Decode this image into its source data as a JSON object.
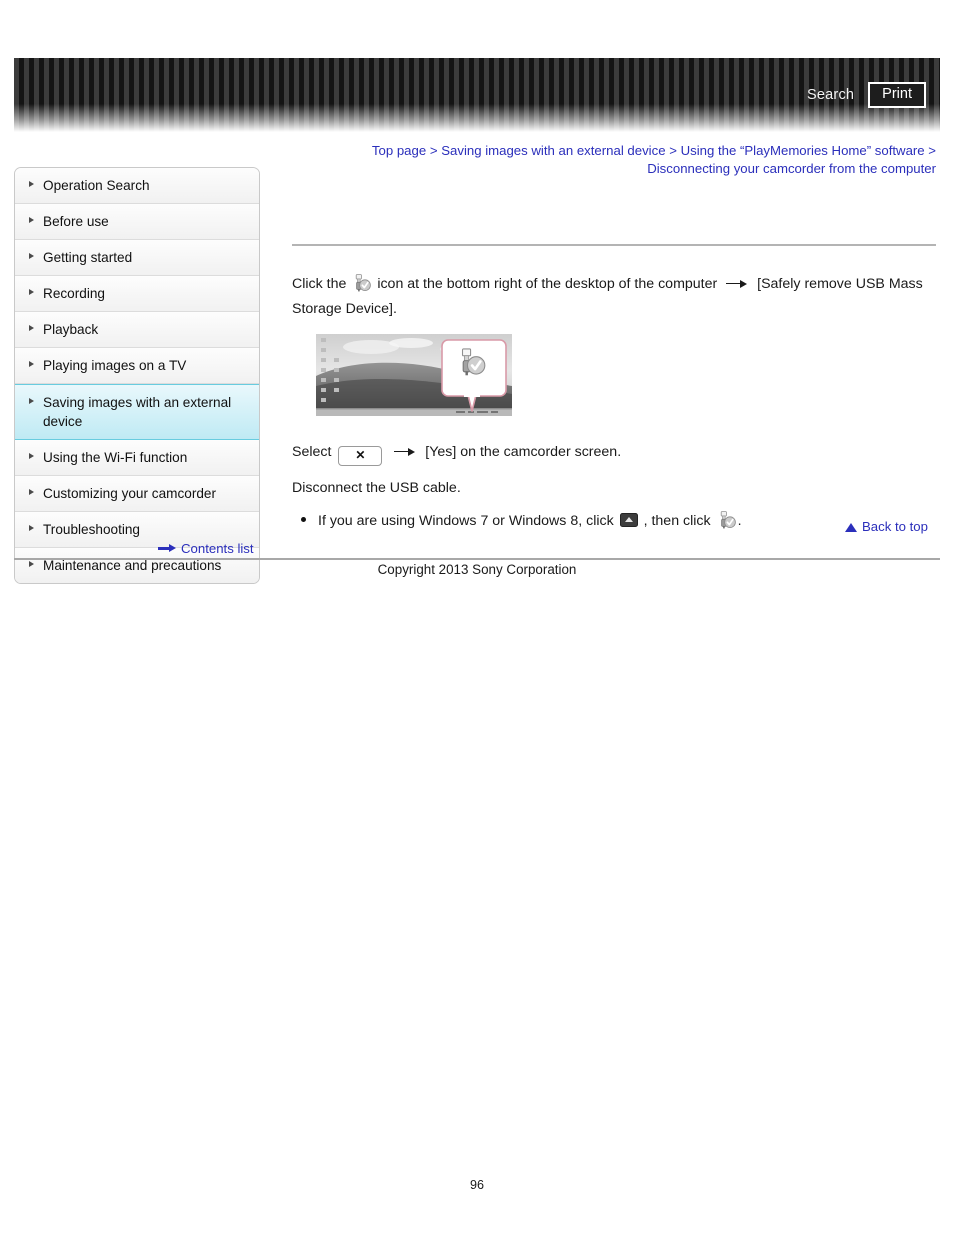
{
  "header": {
    "search_label": "Search",
    "print_label": "Print"
  },
  "breadcrumb": {
    "full_text": "Top page > Saving images with an external device > Using the “PlayMemories Home” software > Disconnecting your camcorder from the computer",
    "items": [
      "Top page",
      "Saving images with an external device",
      "Using the “PlayMemories Home” software",
      "Disconnecting your camcorder from the computer"
    ],
    "separator": ">"
  },
  "sidebar": {
    "items": [
      {
        "label": "Operation Search",
        "selected": false
      },
      {
        "label": "Before use",
        "selected": false
      },
      {
        "label": "Getting started",
        "selected": false
      },
      {
        "label": "Recording",
        "selected": false
      },
      {
        "label": "Playback",
        "selected": false
      },
      {
        "label": "Playing images on a TV",
        "selected": false
      },
      {
        "label": "Saving images with an external device",
        "selected": true
      },
      {
        "label": "Using the Wi-Fi function",
        "selected": false
      },
      {
        "label": "Customizing your camcorder",
        "selected": false
      },
      {
        "label": "Troubleshooting",
        "selected": false
      },
      {
        "label": "Maintenance and precautions",
        "selected": false
      }
    ],
    "contents_list_label": "Contents list"
  },
  "content": {
    "step1_part1": "Click the",
    "step1_part2": "icon at the bottom right of the desktop of the computer",
    "step1_part3": "[Safely remove USB Mass Storage Device].",
    "figure_alt": "Desktop screenshot with callout showing the safely-remove-hardware icon in the notification area",
    "step2_part1": "Select",
    "step2_x_label": "✕",
    "step2_part2": "[Yes] on the camcorder screen.",
    "step3": "Disconnect the USB cable.",
    "note_part1": "If you are using Windows 7 or Windows 8, click",
    "note_part2": ", then click",
    "note_part3": "."
  },
  "footer": {
    "back_to_top_label": "Back to top",
    "copyright": "Copyright 2013 Sony Corporation",
    "page_number": "96"
  },
  "colors": {
    "link_blue": "#2b2fbb",
    "selected_item_cyan": "#bfeaf4",
    "header_stripe_dark": "#141414",
    "header_stripe_light": "#3c3c3c",
    "callout_pink": "#d99aa8"
  }
}
